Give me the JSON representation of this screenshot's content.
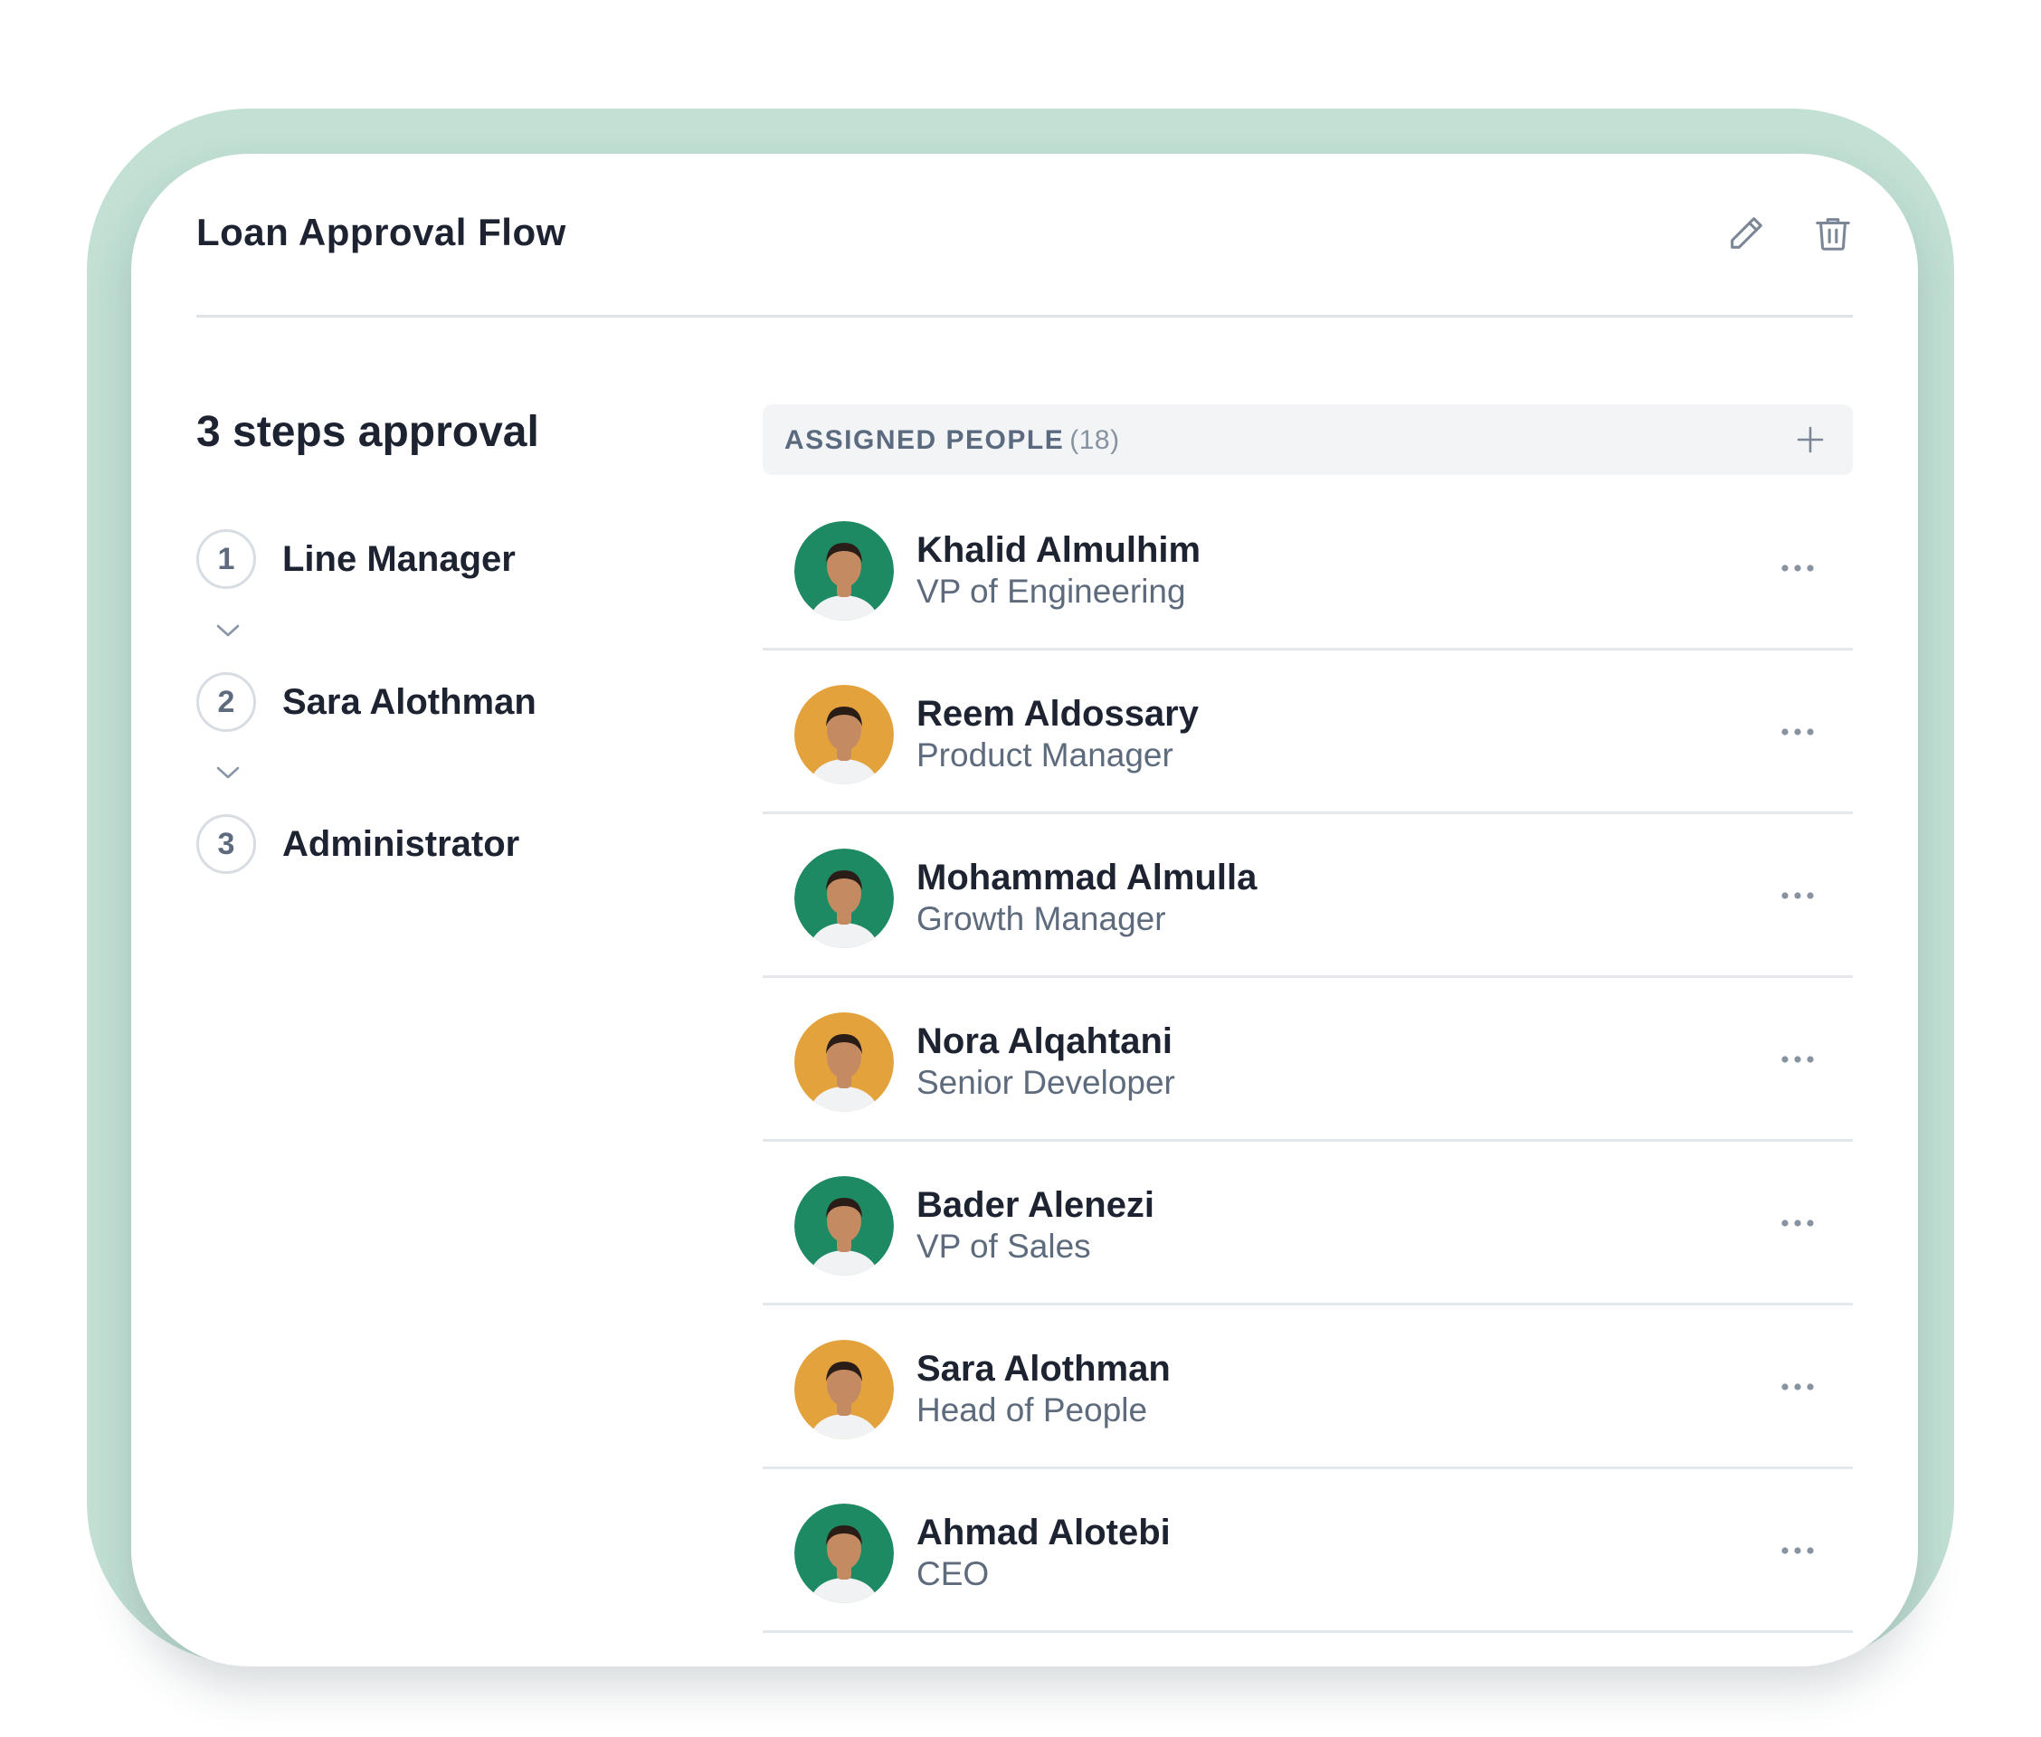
{
  "flow": {
    "title": "Loan Approval Flow",
    "edit_icon": "pencil-icon",
    "delete_icon": "trash-icon"
  },
  "steps": {
    "heading": "3 steps approval",
    "items": [
      {
        "number": "1",
        "label": "Line Manager"
      },
      {
        "number": "2",
        "label": "Sara Alothman"
      },
      {
        "number": "3",
        "label": "Administrator"
      }
    ]
  },
  "people": {
    "header_label": "ASSIGNED PEOPLE",
    "count": "(18)",
    "add_icon": "plus-icon",
    "more_icon": "ellipsis-icon",
    "list": [
      {
        "name": "Khalid Almulhim",
        "role": "VP of Engineering",
        "avatar_bg": "#1e8a63"
      },
      {
        "name": "Reem Aldossary",
        "role": "Product Manager",
        "avatar_bg": "#e3a23c"
      },
      {
        "name": "Mohammad Almulla",
        "role": "Growth Manager",
        "avatar_bg": "#1e8a63"
      },
      {
        "name": "Nora Alqahtani",
        "role": "Senior Developer",
        "avatar_bg": "#e3a23c"
      },
      {
        "name": "Bader Alenezi",
        "role": "VP of Sales",
        "avatar_bg": "#1e8a63"
      },
      {
        "name": "Sara Alothman",
        "role": "Head of People",
        "avatar_bg": "#e3a23c"
      },
      {
        "name": "Ahmad Alotebi",
        "role": "CEO",
        "avatar_bg": "#1e8a63"
      }
    ]
  },
  "colors": {
    "frame": "#c2e0d4",
    "text_primary": "#1d2330",
    "text_secondary": "#5d6b7d",
    "avatar_green": "#1e8a63",
    "avatar_orange": "#e3a23c"
  }
}
